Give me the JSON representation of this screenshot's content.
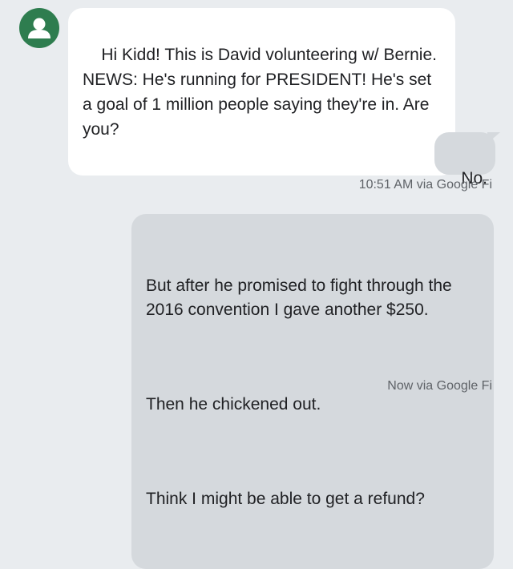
{
  "conversation": {
    "contact_avatar_icon": "person-icon",
    "contact_avatar_color": "#2e7d4f",
    "messages": [
      {
        "direction": "incoming",
        "text": "Hi Kidd! This is David volunteering w/ Bernie. NEWS: He's running for PRESIDENT! He's set a goal of 1 million people saying they're in. Are you?"
      },
      {
        "direction": "outgoing",
        "text": "No.",
        "meta": "10:51 AM via Google Fi"
      },
      {
        "direction": "outgoing",
        "paragraphs": [
          "But after he promised to fight through the 2016 convention I gave another $250.",
          "Then he chickened out.",
          "Think I might be able to get a refund?"
        ],
        "meta": "Now via Google Fi"
      }
    ]
  },
  "colors": {
    "background": "#e9ecef",
    "incoming_bubble": "#ffffff",
    "outgoing_bubble": "#d5d9dd",
    "meta_text": "#5f6368"
  }
}
